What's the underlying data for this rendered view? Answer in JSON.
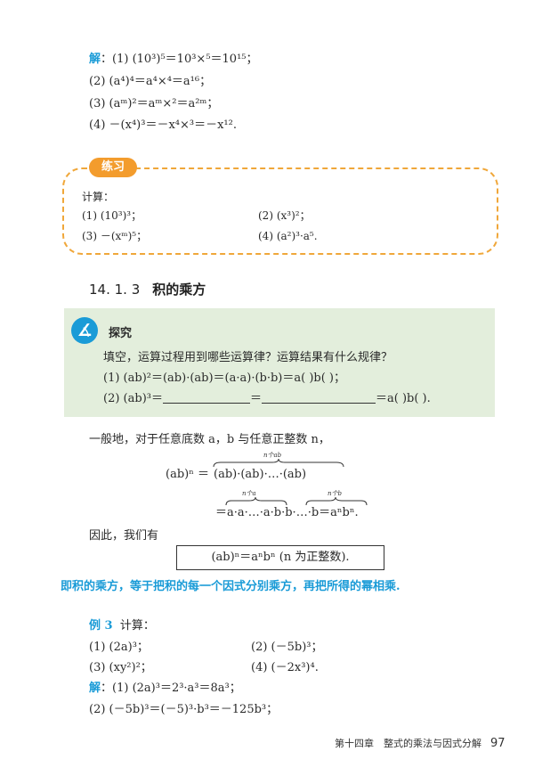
{
  "solution1": {
    "label": "解",
    "lines": [
      "：(1) (10³)⁵＝10³×⁵＝10¹⁵；",
      "(2) (a⁴)⁴＝a⁴×⁴＝a¹⁶；",
      "(3) (aᵐ)²＝aᵐ×²＝a²ᵐ；",
      "(4) －(x⁴)³＝－x⁴×³＝－x¹²."
    ]
  },
  "practice": {
    "tab": "练习",
    "intro": "计算：",
    "items": [
      "(1) (10³)³；",
      "(2) (x³)²；",
      "(3) －(xᵐ)⁵；",
      "(4) (a²)³·a⁵."
    ]
  },
  "section": {
    "number": "14. 1. 3",
    "title": "积的乘方"
  },
  "explore": {
    "title": "探究",
    "prompt": "填空，运算过程用到哪些运算律？运算结果有什么规律？",
    "line1": "(1) (ab)²＝(ab)·(ab)＝(a·a)·(b·b)＝a( )b( )；",
    "line2_start": "(2) (ab)³＝",
    "line2_mid": "＝",
    "line2_end": "＝a( )b( )."
  },
  "general": {
    "intro": "一般地，对于任意底数 a，b 与任意正整数 n，",
    "eq1_lhs": "(ab)ⁿ ＝",
    "eq1_rhs": "(ab)·(ab)·…·(ab)",
    "brace1_label": "n个ab",
    "eq2": "＝a·a·…·a·b·b·…·b＝aⁿbⁿ.",
    "brace2_label": "n个a",
    "brace3_label": "n个b",
    "therefore": "因此，我们有",
    "formula": "(ab)ⁿ＝aⁿbⁿ (n 为正整数).",
    "rule": "即积的乘方，等于把积的每一个因式分别乘方，再把所得的幂相乘."
  },
  "example": {
    "label": "例 3",
    "intro": "计算：",
    "items": [
      "(1) (2a)³；",
      "(2) (－5b)³；",
      "(3) (xy²)²；",
      "(4) (－2x³)⁴."
    ],
    "solution_label": "解",
    "solution_lines": [
      "：(1) (2a)³＝2³·a³＝8a³；",
      "(2) (－5b)³＝(－5)³·b³＝－125b³；"
    ]
  },
  "footer": {
    "chapter": "第十四章　整式的乘法与因式分解",
    "page": "97"
  },
  "colors": {
    "accent_blue": "#1a9bd7",
    "practice_orange": "#f39c2d",
    "explore_green": "#e3eedc"
  }
}
